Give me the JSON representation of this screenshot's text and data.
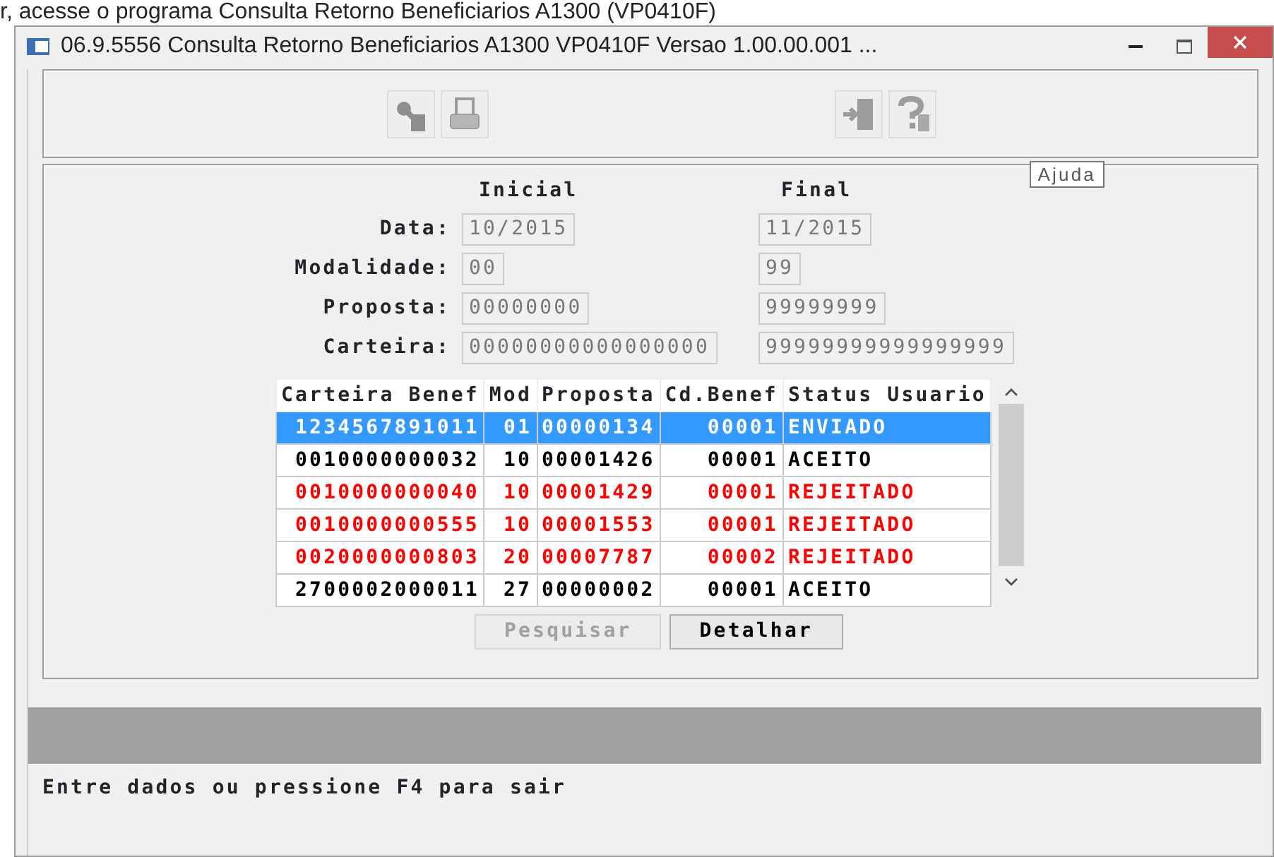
{
  "caption": "r, acesse o programa Consulta Retorno Beneficiarios A1300 (VP0410F)",
  "window": {
    "title": "06.9.5556  Consulta Retorno Beneficiarios A1300 VP0410F Versao 1.00.00.001 ..."
  },
  "toolbar": [
    {
      "kind": "key",
      "disabled": true
    },
    {
      "kind": "printer",
      "disabled": true
    },
    {
      "kind": "exit",
      "disabled": true
    },
    {
      "kind": "help",
      "disabled": true
    }
  ],
  "tooltip": "Ajuda",
  "form": {
    "headers": [
      "Inicial",
      "Final"
    ],
    "fields": [
      {
        "label": "Data:",
        "initial": "10/2015",
        "final": "11/2015"
      },
      {
        "label": "Modalidade:",
        "initial": "00",
        "final": "99"
      },
      {
        "label": "Proposta:",
        "initial": "00000000",
        "final": "99999999"
      },
      {
        "label": "Carteira:",
        "initial": "00000000000000000",
        "final": "99999999999999999"
      }
    ]
  },
  "table": {
    "columns": [
      "Carteira Benef",
      "Mod",
      "Proposta",
      "Cd.Benef",
      "Status Usuario"
    ],
    "rows": [
      {
        "cells": [
          "1234567891011",
          "01",
          "00000134",
          "00001",
          "ENVIADO"
        ],
        "selected": true
      },
      {
        "cells": [
          "0010000000032",
          "10",
          "00001426",
          "00001",
          "ACEITO"
        ],
        "selected": false,
        "kind": "normal"
      },
      {
        "cells": [
          "0010000000040",
          "10",
          "00001429",
          "00001",
          "REJEITADO"
        ],
        "selected": false,
        "kind": "rejected"
      },
      {
        "cells": [
          "0010000000555",
          "10",
          "00001553",
          "00001",
          "REJEITADO"
        ],
        "selected": false,
        "kind": "rejected"
      },
      {
        "cells": [
          "0020000000803",
          "20",
          "00007787",
          "00002",
          "REJEITADO"
        ],
        "selected": false,
        "kind": "rejected"
      },
      {
        "cells": [
          "2700002000011",
          "27",
          "00000002",
          "00001",
          "ACEITO"
        ],
        "selected": false,
        "kind": "normal"
      }
    ]
  },
  "buttons": [
    {
      "label": "Pesquisar",
      "disabled": true
    },
    {
      "label": "Detalhar",
      "disabled": false
    }
  ],
  "status_bar": "Entre dados ou pressione F4 para sair"
}
